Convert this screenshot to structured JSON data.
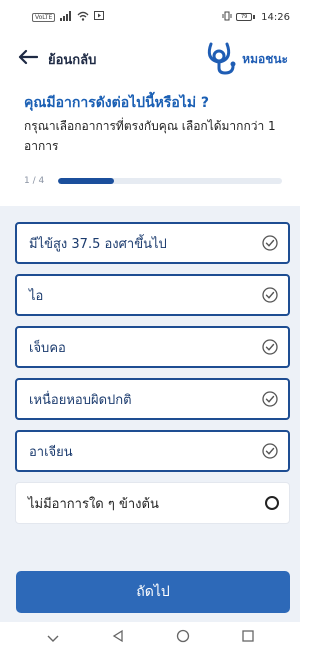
{
  "status_bar": {
    "carrier_badge": "VoLTE",
    "battery": "79",
    "time": "14:26"
  },
  "header": {
    "back_label": "ย้อนกลับ",
    "logo_text": "หมอชนะ"
  },
  "question": {
    "title": "คุณมีอาการดังต่อไปนี้หรือไม่ ?",
    "subtitle": "กรุณาเลือกอาการที่ตรงกับคุณ เลือกได้มากกว่า 1 อาการ"
  },
  "progress": {
    "text": "1 / 4",
    "fraction": 0.25
  },
  "options": [
    {
      "label": "มีไข้สูง 37.5 องศาขึ้นไป",
      "icon": "check-circle-icon",
      "selected": true
    },
    {
      "label": "ไอ",
      "icon": "check-circle-icon",
      "selected": true
    },
    {
      "label": "เจ็บคอ",
      "icon": "check-circle-icon",
      "selected": true
    },
    {
      "label": "เหนื่อยหอบผิดปกติ",
      "icon": "check-circle-icon",
      "selected": true
    },
    {
      "label": "อาเจียน",
      "icon": "check-circle-icon",
      "selected": true
    },
    {
      "label": "ไม่มีอาการใด ๆ ข้างต้น",
      "icon": "radio-icon",
      "selected": false
    }
  ],
  "next_button": {
    "label": "ถัดไป"
  },
  "colors": {
    "primary": "#1a5fb4",
    "button": "#2d69b8",
    "selected_border": "#1e4d92",
    "options_background": "#edf1f7"
  }
}
